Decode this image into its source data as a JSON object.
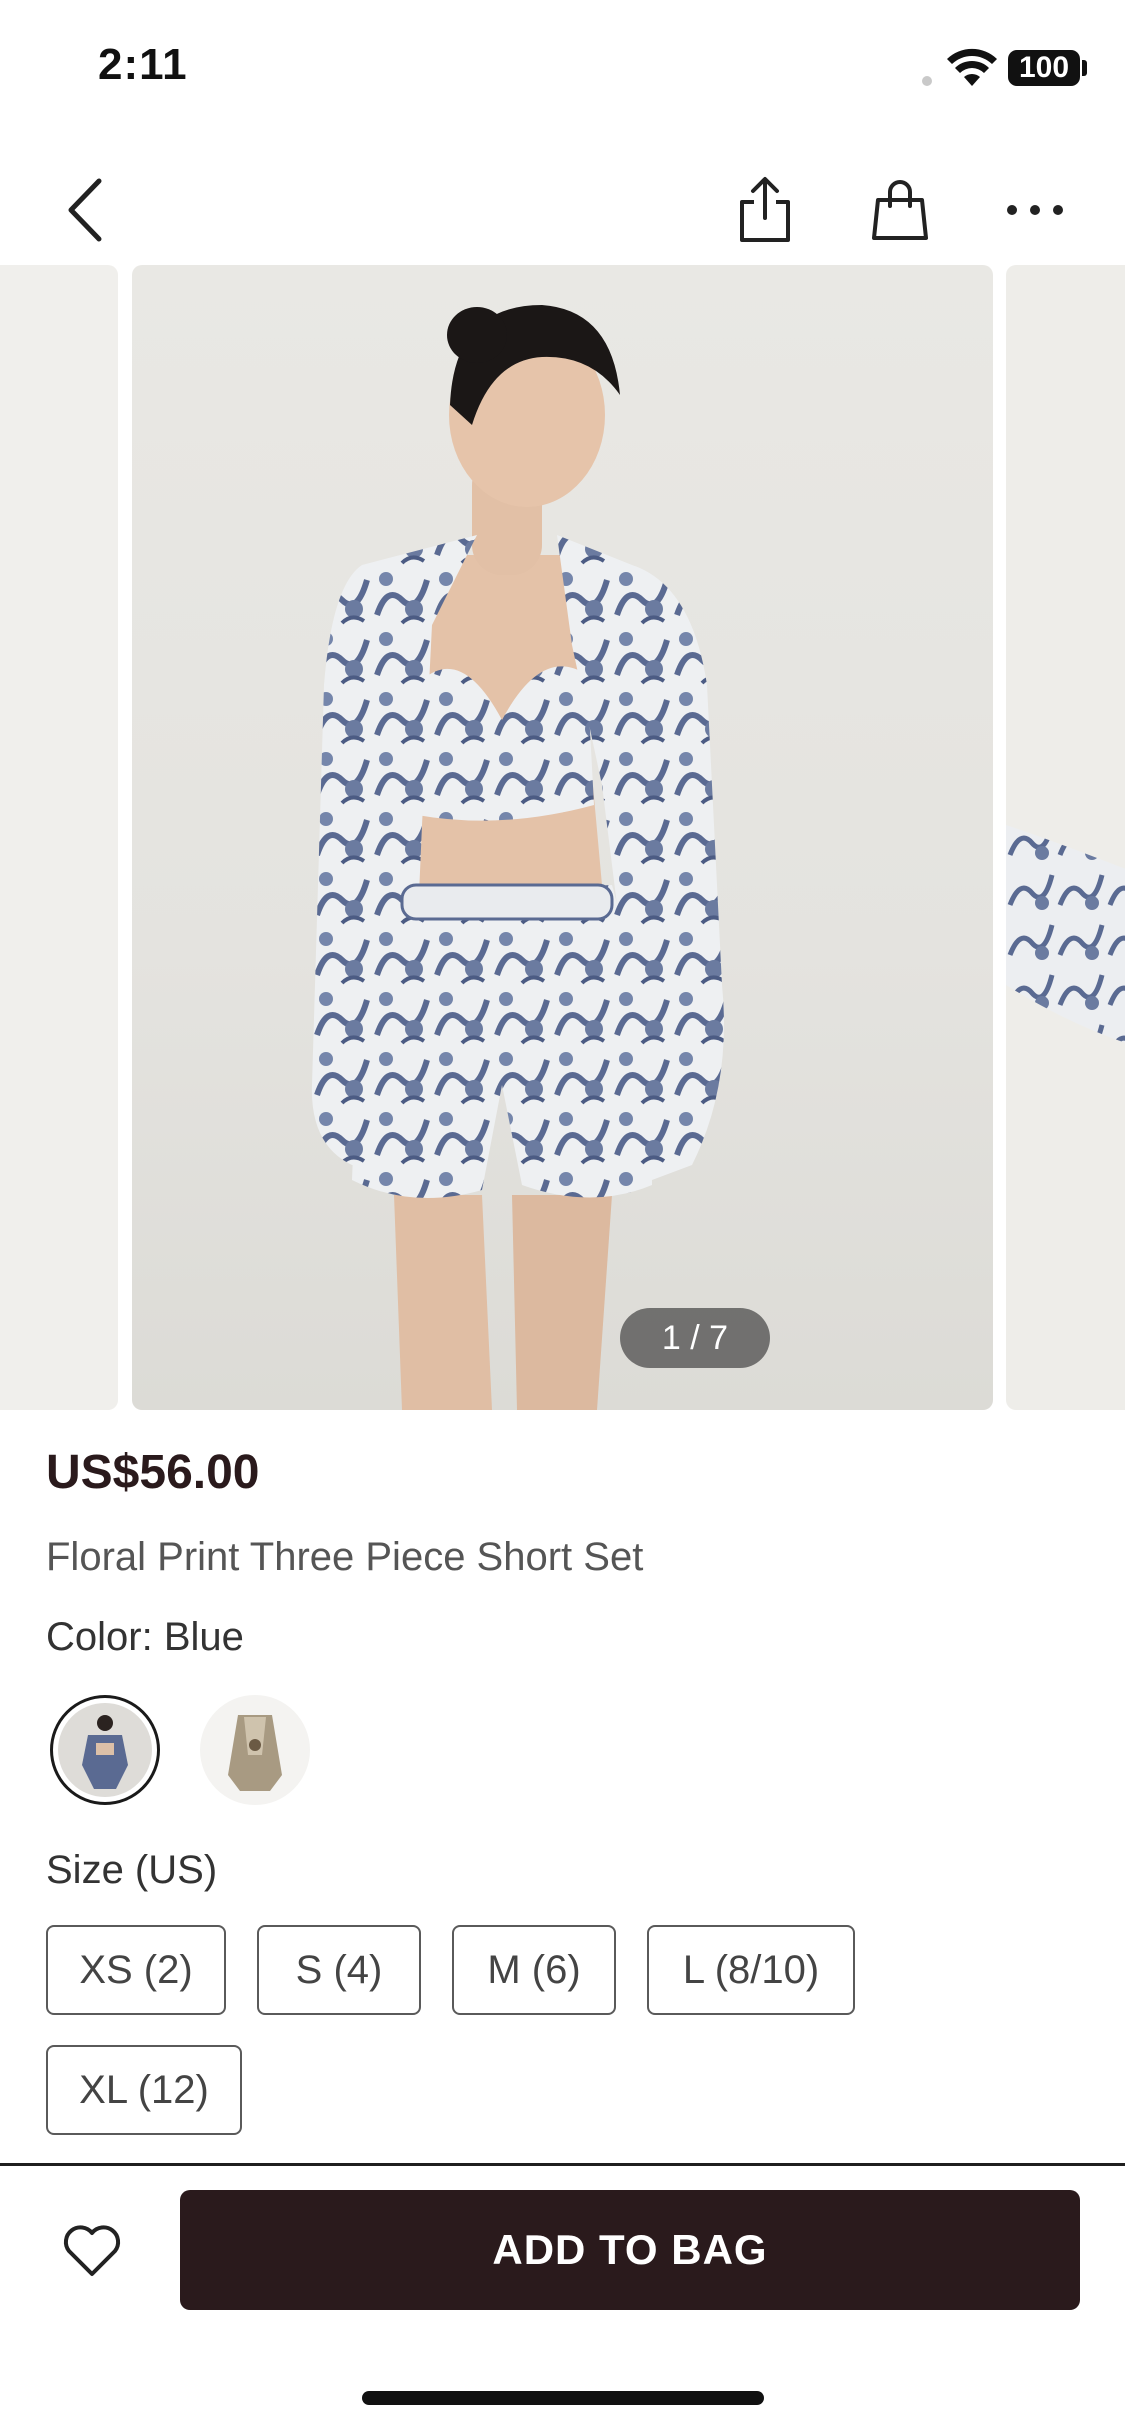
{
  "status": {
    "time": "2:11",
    "battery": "100"
  },
  "nav": {
    "back_icon": "chevron-left-icon",
    "share_icon": "share-icon",
    "bag_icon": "shopping-bag-icon",
    "more_icon": "more-horizontal-icon"
  },
  "carousel": {
    "page_indicator": "1 / 7"
  },
  "product": {
    "price": "US$56.00",
    "title": "Floral Print Three Piece Short Set",
    "color_label": "Color: Blue"
  },
  "swatches": [
    {
      "name": "blue",
      "selected": true
    },
    {
      "name": "beige",
      "selected": false
    }
  ],
  "size": {
    "label": "Size (US)",
    "options": [
      "XS (2)",
      "S (4)",
      "M (6)",
      "L (8/10)",
      "XL (12)"
    ]
  },
  "footer": {
    "wishlist_icon": "heart-icon",
    "add_to_bag": "ADD TO BAG"
  },
  "colors": {
    "brand_dark": "#2a1a1c",
    "print_blue": "#5a6a92"
  }
}
